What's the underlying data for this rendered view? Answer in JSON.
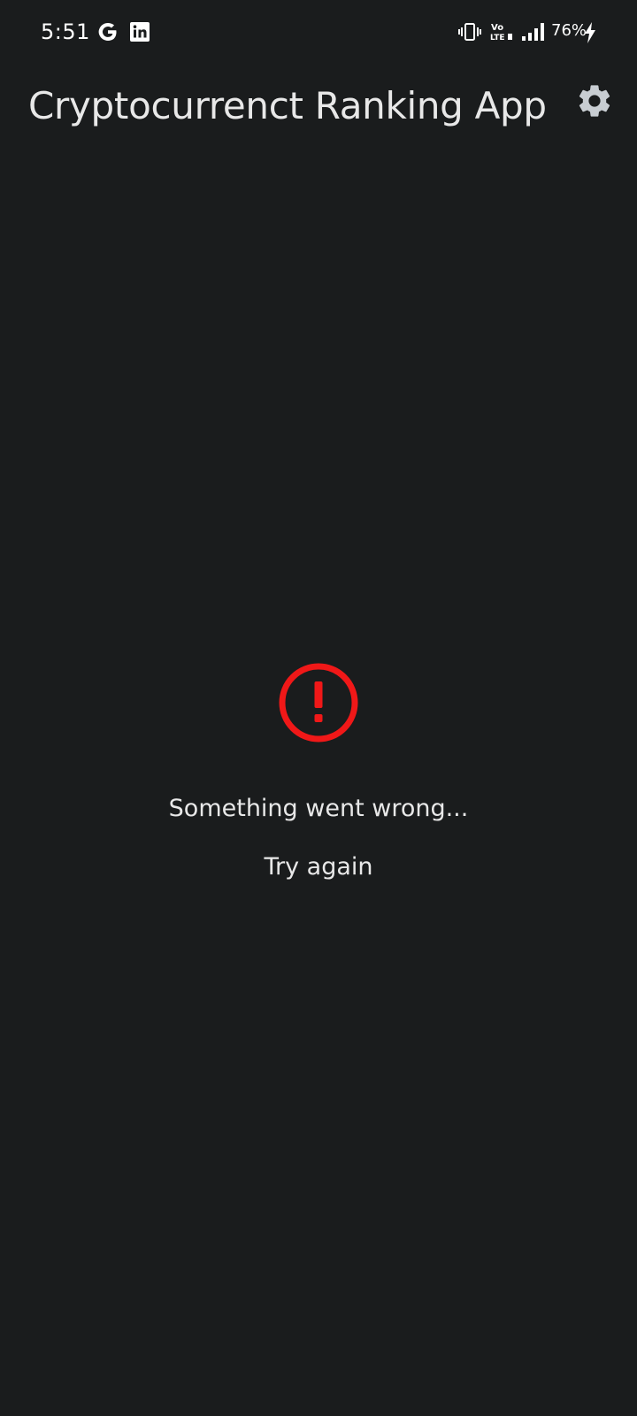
{
  "status_bar": {
    "time": "5:51",
    "battery_percent": "76%",
    "icons": [
      "google-icon",
      "linkedin-icon",
      "vibrate-icon",
      "volte-icon",
      "signal-icon",
      "charging-icon"
    ]
  },
  "app_bar": {
    "title": "Cryptocurrenct Ranking App",
    "settings_icon": "gear-icon"
  },
  "error": {
    "icon": "error-exclamation-icon",
    "icon_color": "#f01818",
    "message": "Something went wrong...",
    "retry_label": "Try again"
  },
  "colors": {
    "background": "#1a1c1d",
    "text": "#e8e8e8",
    "icon": "#c8cdd2"
  }
}
